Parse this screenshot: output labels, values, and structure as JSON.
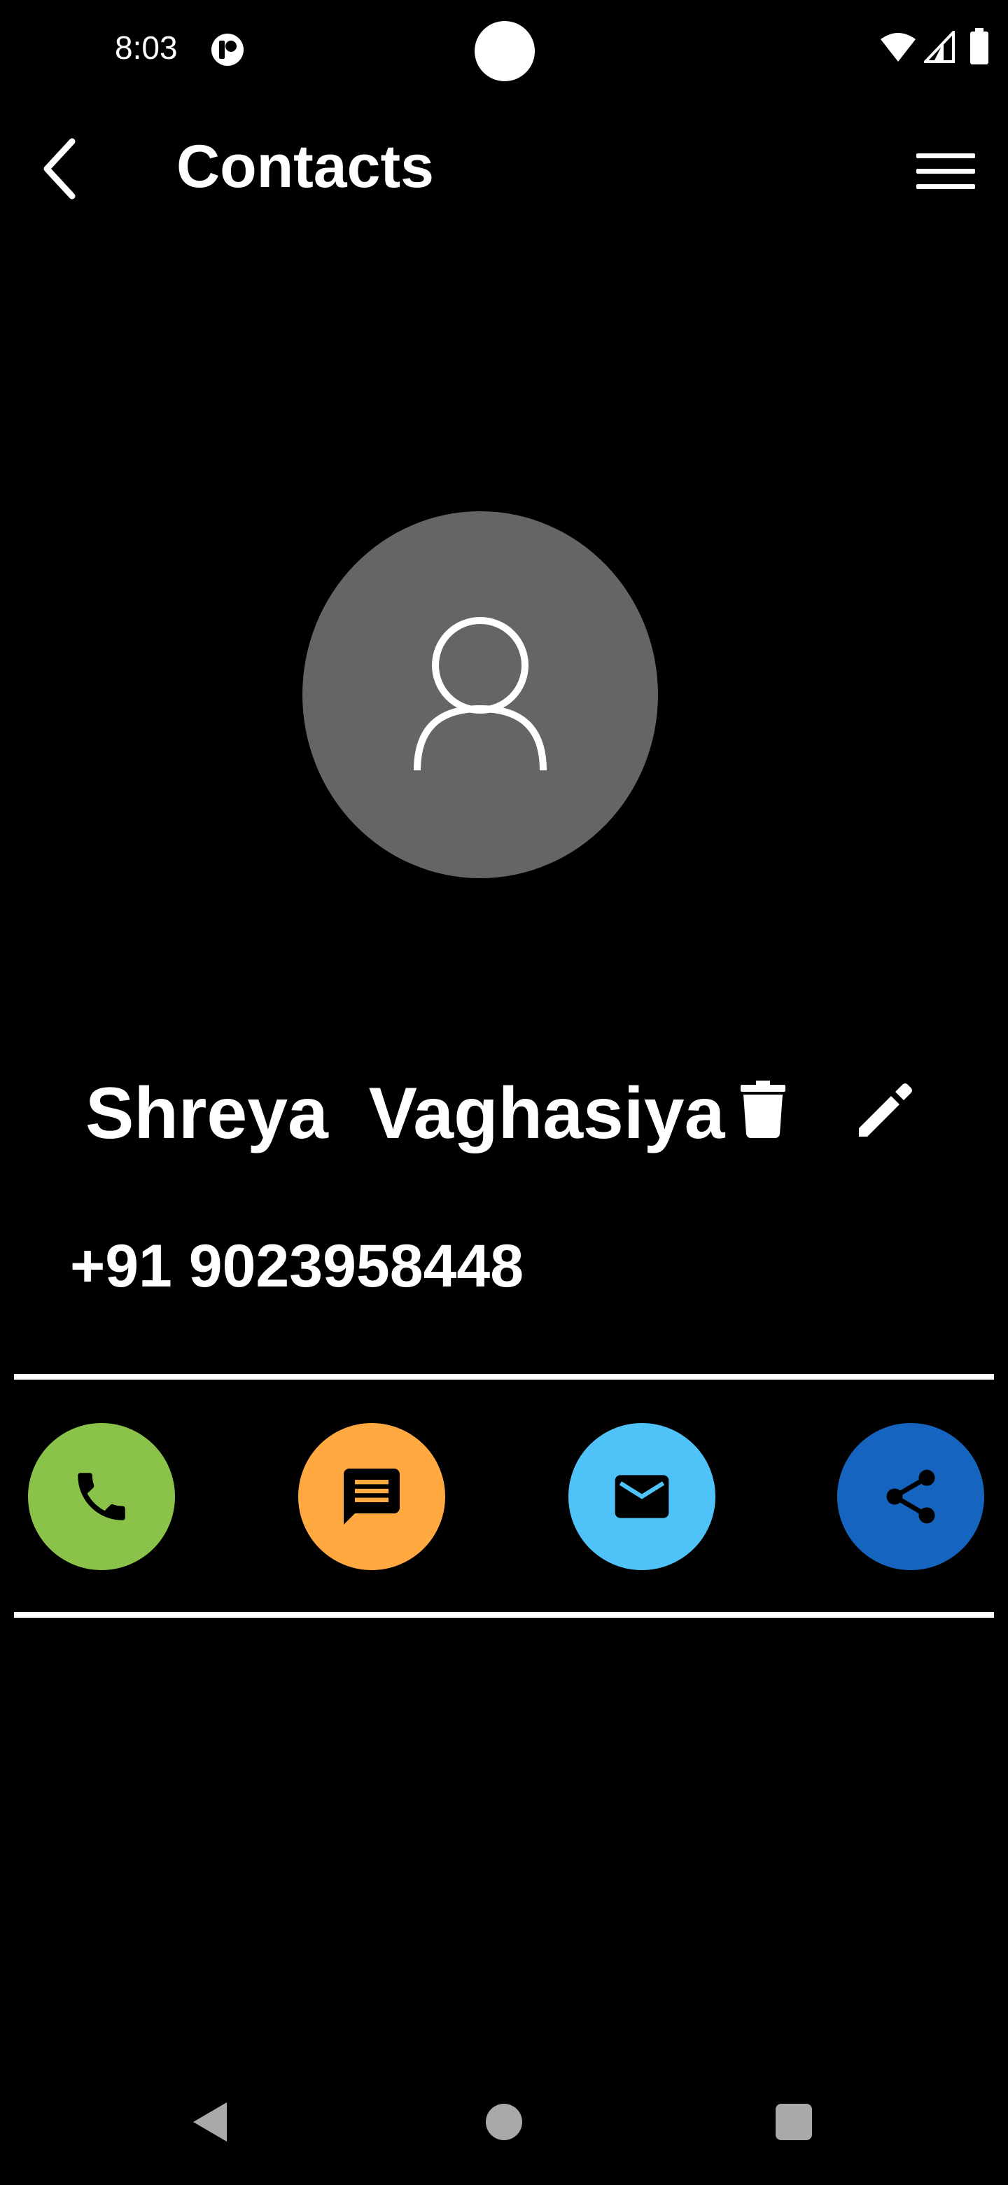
{
  "status_bar": {
    "time": "8:03",
    "app_icon": "app-notification-icon",
    "wifi_icon": "wifi-icon",
    "signal_icon": "cell-signal-icon",
    "battery_icon": "battery-icon"
  },
  "app_bar": {
    "title": "Contacts",
    "back_icon": "chevron-left-icon",
    "menu_icon": "hamburger-menu-icon"
  },
  "contact": {
    "avatar_icon": "person-outline-icon",
    "name": "Shreya  Vaghasiya",
    "phone": "+91 9023958448"
  },
  "actions": [
    {
      "name": "call",
      "icon": "phone-icon",
      "color": "#8bc34a"
    },
    {
      "name": "message",
      "icon": "message-icon",
      "color": "#ffa940"
    },
    {
      "name": "email",
      "icon": "email-icon",
      "color": "#4fc3f7"
    },
    {
      "name": "share",
      "icon": "share-icon",
      "color": "#1565c0"
    }
  ],
  "colors": {
    "background": "#000000",
    "avatar": "#656565",
    "text": "#ffffff",
    "nav_icons": "#a9a9a9"
  }
}
